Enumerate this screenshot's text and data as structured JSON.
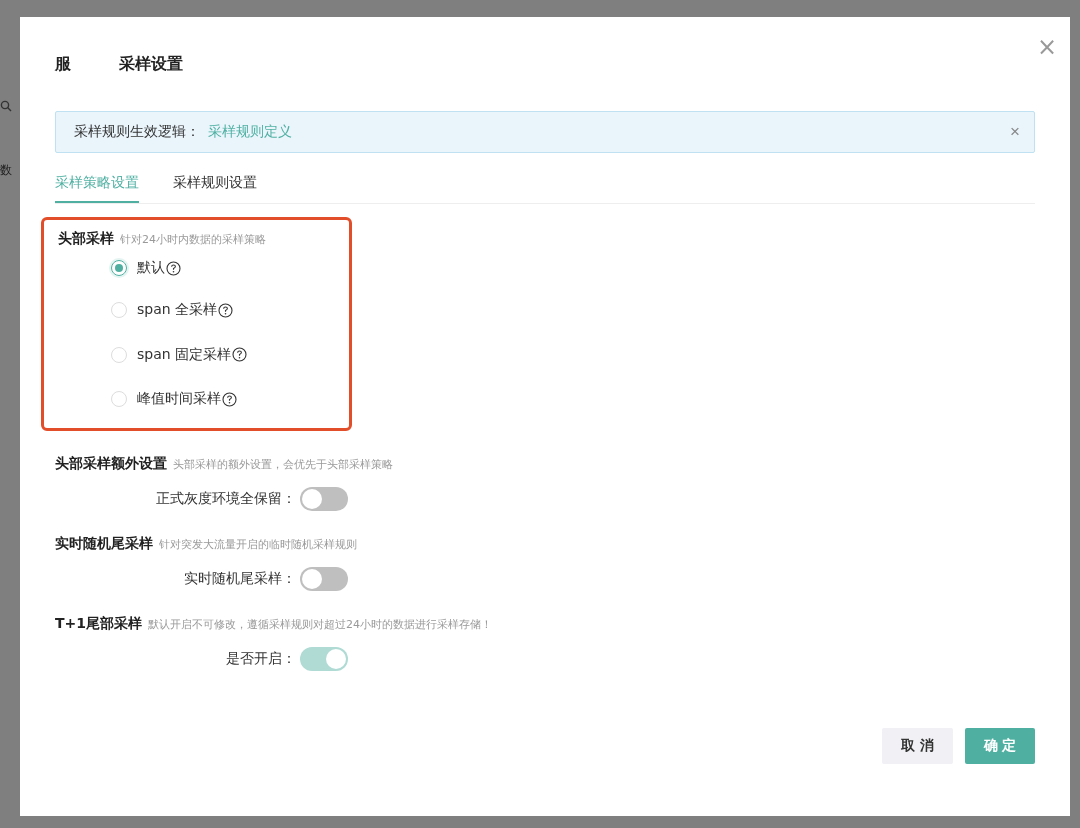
{
  "background": {
    "text": "数"
  },
  "dialog": {
    "title_prefix": "服",
    "title": "采样设置",
    "close": "×"
  },
  "alert": {
    "label": "采样规则生效逻辑：",
    "link": "采样规则定义",
    "close": "×"
  },
  "tabs": [
    {
      "label": "采样策略设置",
      "selected": true
    },
    {
      "label": "采样规则设置",
      "selected": false
    }
  ],
  "head_sampling": {
    "title": "头部采样",
    "hint": "针对24小时内数据的采样策略",
    "highlighted": true,
    "options": [
      {
        "label": "默认",
        "selected": true
      },
      {
        "label": "span 全采样",
        "selected": false
      },
      {
        "label": "span 固定采样",
        "selected": false
      },
      {
        "label": "峰值时间采样",
        "selected": false
      }
    ]
  },
  "sections": [
    {
      "title": "头部采样额外设置",
      "hint": "头部采样的额外设置，会优先于头部采样策略",
      "field": "正式灰度环境全保留：",
      "on": false,
      "disabled": false
    },
    {
      "title": "实时随机尾采样",
      "hint": "针对突发大流量开启的临时随机采样规则",
      "field": "实时随机尾采样：",
      "on": false,
      "disabled": false
    },
    {
      "title": "T+1尾部采样",
      "hint": "默认开启不可修改，遵循采样规则对超过24小时的数据进行采样存储！",
      "field": "是否开启：",
      "on": true,
      "disabled": true
    }
  ],
  "buttons": [
    {
      "label": "取 消",
      "kind": "default"
    },
    {
      "label": "确 定",
      "kind": "primary"
    }
  ]
}
